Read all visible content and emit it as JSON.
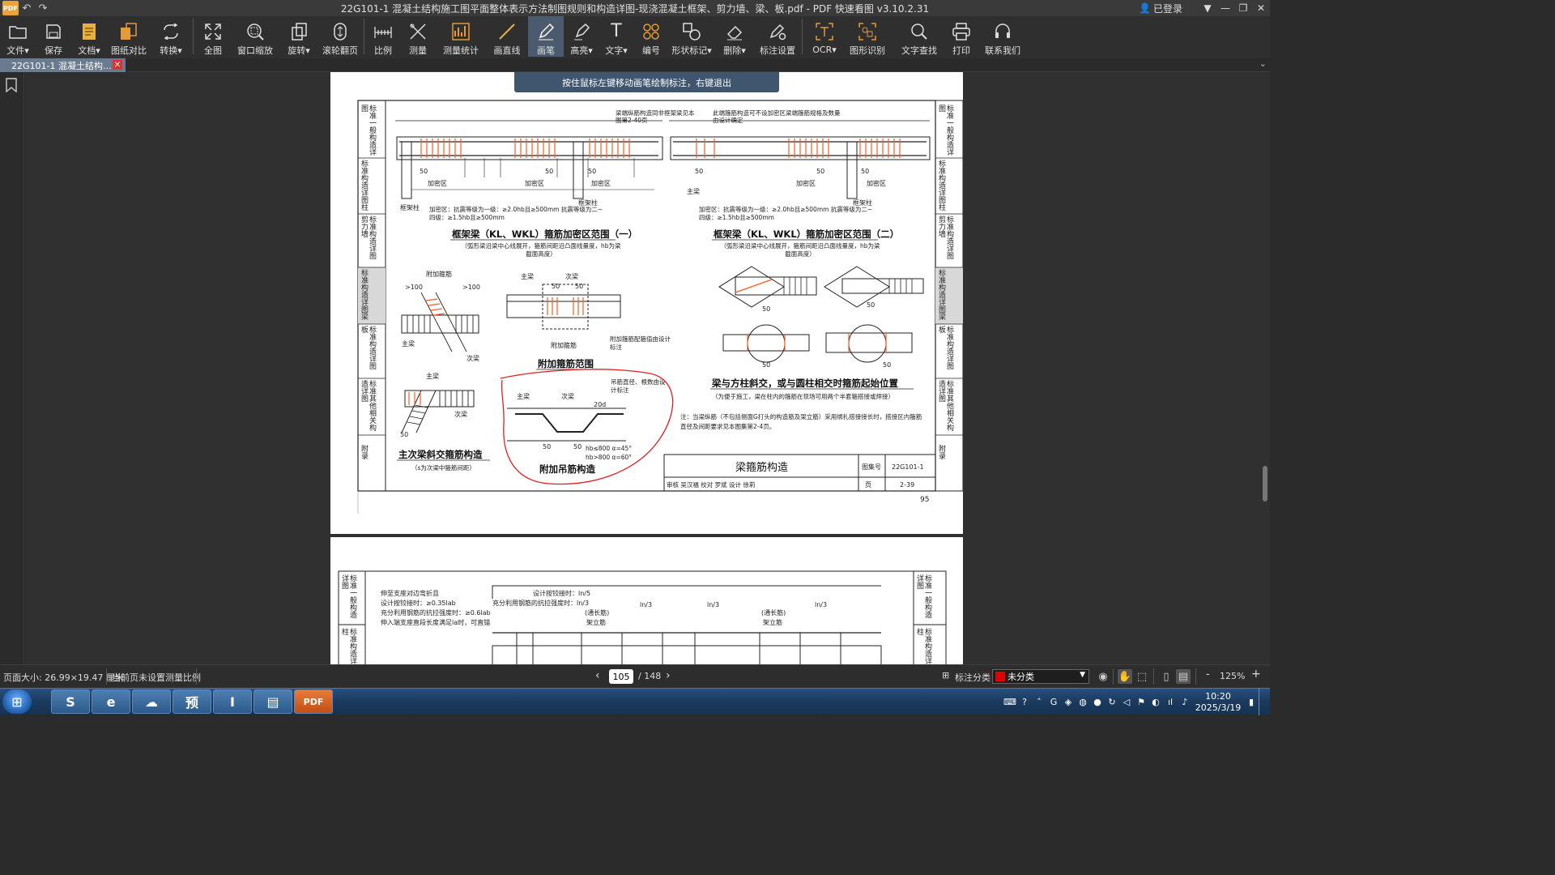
{
  "titlebar": {
    "title": "22G101-1 混凝土结构施工图平面整体表示方法制图规则和构造详图-现浇混凝土框架、剪力墙、梁、板.pdf - PDF 快速看图 v3.10.2.31",
    "login": "已登录",
    "app_logo": "PDF"
  },
  "toolbar": {
    "items": [
      {
        "label": "文件",
        "icon": "folder-icon",
        "dropdown": "▾"
      },
      {
        "label": "保存",
        "icon": "save-icon"
      },
      {
        "label": "文档",
        "icon": "document-icon",
        "dropdown": "▾"
      },
      {
        "label": "图纸对比",
        "icon": "compare-icon"
      },
      {
        "label": "转换",
        "icon": "convert-icon",
        "dropdown": "▾"
      },
      {
        "label": "全图",
        "icon": "fit-all-icon"
      },
      {
        "label": "窗口缩放",
        "icon": "zoom-window-icon"
      },
      {
        "label": "旋转",
        "icon": "rotate-icon",
        "dropdown": "▾"
      },
      {
        "label": "滚轮翻页",
        "icon": "scroll-page-icon"
      },
      {
        "label": "比例",
        "icon": "scale-icon"
      },
      {
        "label": "测量",
        "icon": "measure-icon"
      },
      {
        "label": "测量统计",
        "icon": "measure-stats-icon"
      },
      {
        "label": "画直线",
        "icon": "line-icon"
      },
      {
        "label": "画笔",
        "icon": "pen-icon"
      },
      {
        "label": "高亮",
        "icon": "highlight-icon",
        "dropdown": "▾"
      },
      {
        "label": "文字",
        "icon": "text-icon",
        "dropdown": "▾"
      },
      {
        "label": "编号",
        "icon": "numbering-icon"
      },
      {
        "label": "形状标记",
        "icon": "shape-mark-icon",
        "dropdown": "▾"
      },
      {
        "label": "删除",
        "icon": "eraser-icon",
        "dropdown": "▾"
      },
      {
        "label": "标注设置",
        "icon": "annotation-settings-icon"
      },
      {
        "label": "OCR",
        "icon": "ocr-icon",
        "dropdown": "▾"
      },
      {
        "label": "图形识别",
        "icon": "shape-recognition-icon"
      },
      {
        "label": "文字查找",
        "icon": "search-icon"
      },
      {
        "label": "打印",
        "icon": "print-icon"
      },
      {
        "label": "联系我们",
        "icon": "headset-icon"
      }
    ]
  },
  "tab": {
    "label": "22G101-1 混凝土结构...",
    "close": "✕"
  },
  "tooltip": "按住鼠标左键移动画笔绘制标注，右键退出",
  "drawing": {
    "side_tabs": [
      "标准一般构造详图",
      "标准构造详图柱",
      "标准构造详图剪力墙",
      "标准构造详图梁",
      "标准构造详图板",
      "标准其他相关构造详图",
      "附录"
    ],
    "heading1": "框架梁（KL、WKL）箍筋加密区范围（一）",
    "heading1_note": "（弧形梁沿梁中心线展开，箍筋间距沿凸面线量度，hb为梁截面高度）",
    "heading1_text": "加密区：抗震等级为一级：≥2.0hb且≥500mm  抗震等级为二~四级：≥1.5hb且≥500mm",
    "heading2": "框架梁（KL、WKL）箍筋加密区范围（二）",
    "heading2_note": "（弧形梁沿梁中心线展开，箍筋间距沿凸面线量度，hb为梁截面高度）",
    "heading3": "附加箍筋范围",
    "heading3_note": "附加箍筋配箍值由设计标注",
    "heading4": "主次梁斜交箍筋构造",
    "heading4_note": "（s为次梁中箍筋间距）",
    "heading5": "附加吊筋构造",
    "heading5_note": "吊筋直径、根数由设计标注",
    "heading5_text1": "hb≤800 α=45°",
    "heading5_text2": "hb>800 α=60°",
    "heading6": "梁与方柱斜交，或与圆柱相交时箍筋起始位置",
    "heading6_note": "（为便于施工，梁在柱内的箍筋在现场可用两个半套箍搭接或焊接）",
    "note": "注：当梁纵筋（不包括侧面G打头的构造筋及架立筋）采用绑扎搭接接长时，搭接区内箍筋直径及间距要求见本图集第2-4页。",
    "label_densify": "加密区",
    "label_column": "框架柱",
    "label_main_beam": "主梁",
    "label_secondary_beam": "次梁",
    "label_extra_stirrup": "附加箍筋",
    "label_dim_50": "50",
    "label_dim_100": ">100",
    "label_20d": "20d",
    "callout1": "梁端纵筋构造同非框架梁见本图第2-40页",
    "callout2": "此端箍筋构造可不设加密区梁端箍筋规格及数量由设计确定",
    "title_block": {
      "title": "梁箍筋构造",
      "atlas_label": "图集号",
      "atlas_no": "22G101-1",
      "page_label": "页",
      "page_no": "2-39",
      "roles": "审核 吴汉福  校对 罗斌  设计 徐莉"
    },
    "page_number": "95",
    "page2_text1": "伸至支座对边弯折且",
    "page2_text2": "设计按铰接时：≥0.35lab",
    "page2_text3": "充分利用钢筋的抗拉强度时：≥0.6lab",
    "page2_text4": "伸入端支座直段长度满足la时，可直锚",
    "page2_text5": "设计按铰接时：ln/5",
    "page2_text6": "充分利用钢筋的抗拉强度时：ln/3",
    "page2_text7": "(通长筋)",
    "page2_text8": "架立筋",
    "page2_text9": "ln/3",
    "page2_side_tabs": [
      "标准一般构造详图",
      "标准构造详图柱"
    ]
  },
  "statusbar": {
    "page_size": "页面大小: 26.99×19.47 厘米",
    "scale_status": "当前页未设置测量比例",
    "current_page": "105",
    "total_pages": "/ 148",
    "category_label": "标注分类",
    "category_value": "未分类",
    "zoom": "125%",
    "minus": "-",
    "plus": "+"
  },
  "taskbar": {
    "apps": [
      {
        "icon": "edge-browser-icon",
        "glyph": "S"
      },
      {
        "icon": "ie-browser-icon",
        "glyph": "e"
      },
      {
        "icon": "cloud-app-icon",
        "glyph": "☁"
      },
      {
        "icon": "preview-app-icon",
        "glyph": "预"
      },
      {
        "icon": "text-app-icon",
        "glyph": "I"
      },
      {
        "icon": "file-explorer-icon",
        "glyph": "▤"
      },
      {
        "icon": "pdf-viewer-icon",
        "glyph": "PDF"
      }
    ],
    "time": "10:20",
    "date": "2025/3/19"
  },
  "colors": {
    "accent": "#4b5a6e",
    "annotation_red": "#e02020",
    "rebar_orange": "#ff5a1f"
  }
}
